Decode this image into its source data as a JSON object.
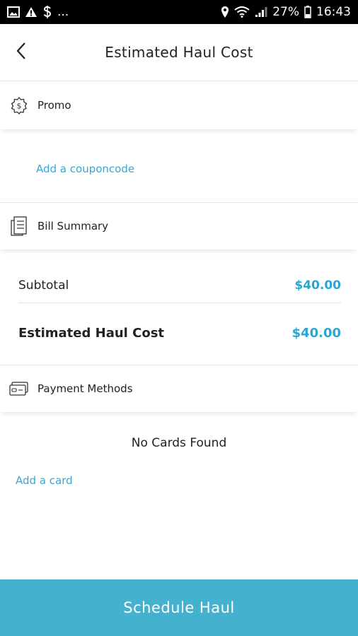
{
  "status_bar": {
    "battery": "27%",
    "time": "16:43",
    "overflow": "..."
  },
  "header": {
    "title": "Estimated Haul Cost"
  },
  "promo": {
    "label": "Promo",
    "add_coupon_link": "Add a couponcode"
  },
  "bill_summary": {
    "label": "Bill Summary",
    "subtotal_label": "Subtotal",
    "subtotal_value": "$40.00",
    "estimated_label": "Estimated Haul Cost",
    "estimated_value": "$40.00"
  },
  "payment_methods": {
    "label": "Payment Methods",
    "empty_text": "No Cards Found",
    "add_card_link": "Add a card"
  },
  "footer": {
    "schedule_label": "Schedule Haul"
  },
  "colors": {
    "accent": "#44b1cf",
    "link": "#3aa6cf",
    "amount": "#2aa5d3"
  },
  "icons": [
    "image-icon",
    "warning-icon",
    "dollar-icon",
    "location-icon",
    "wifi-icon",
    "signal-icon",
    "battery-icon",
    "back-arrow-icon",
    "promo-badge-icon",
    "receipt-icon",
    "credit-card-icon"
  ]
}
